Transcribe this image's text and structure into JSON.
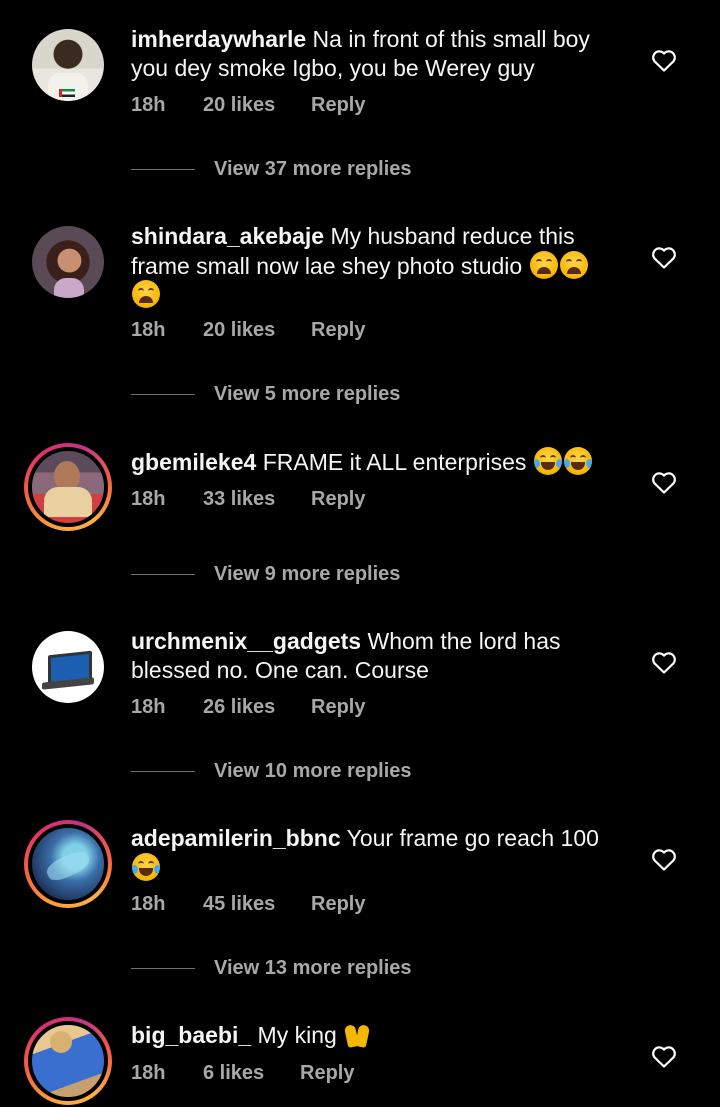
{
  "comments": [
    {
      "username": "imherdaywharle",
      "text": "Na in front of this small boy you dey smoke Igbo, you be Werey guy",
      "time": "18h",
      "likes": "20 likes",
      "reply": "Reply",
      "view_replies": "View 37 more replies",
      "avatar_icon": "avatar-photo",
      "has_story": false
    },
    {
      "username": "shindara_akebaje",
      "text": "My husband reduce this frame small now lae shey photo studio",
      "emoji": [
        "weary-face-emoji",
        "weary-face-emoji",
        "weary-face-emoji"
      ],
      "time": "18h",
      "likes": "20 likes",
      "reply": "Reply",
      "view_replies": "View 5 more replies",
      "avatar_icon": "avatar-photo",
      "has_story": false
    },
    {
      "username": "gbemileke4",
      "text": "FRAME it ALL enterprises",
      "emoji": [
        "tears-of-joy-emoji",
        "tears-of-joy-emoji"
      ],
      "time": "18h",
      "likes": "33 likes",
      "reply": "Reply",
      "view_replies": "View 9 more replies",
      "avatar_icon": "avatar-photo",
      "has_story": true
    },
    {
      "username": "urchmenix__gadgets",
      "text": "Whom the lord has blessed no. One can.  Course",
      "time": "18h",
      "likes": "26 likes",
      "reply": "Reply",
      "view_replies": "View 10 more replies",
      "avatar_icon": "laptop-photo",
      "has_story": false
    },
    {
      "username": "adepamilerin_bbnc",
      "text": "Your frame go reach 100",
      "emoji": [
        "tears-of-joy-emoji"
      ],
      "time": "18h",
      "likes": "45 likes",
      "reply": "Reply",
      "view_replies": "View 13 more replies",
      "avatar_icon": "avatar-photo",
      "has_story": true
    },
    {
      "username": "big_baebi_",
      "text": "My king",
      "emoji": [
        "raising-hands-emoji"
      ],
      "time": "18h",
      "likes": "6 likes",
      "reply": "Reply",
      "avatar_icon": "avatar-photo",
      "has_story": true
    }
  ],
  "colors": {
    "background": "#000000",
    "text": "#f5f5f5",
    "secondary": "#a8a8a8",
    "story_ring": "#e1306c"
  }
}
